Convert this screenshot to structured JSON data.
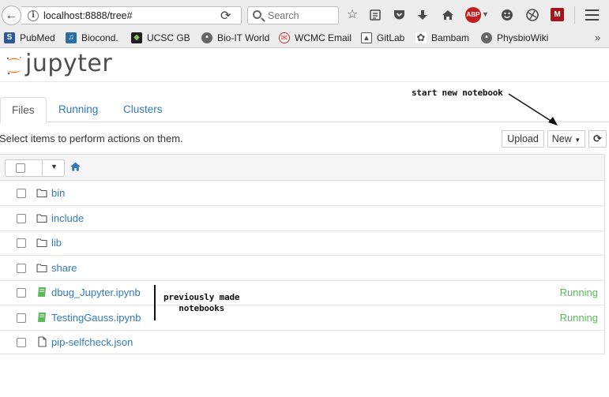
{
  "browser": {
    "url": "localhost:8888/tree#",
    "search_placeholder": "Search",
    "abp_label": "ABP",
    "bookmarks": [
      {
        "label": "PubMed",
        "icon": "pubmed-icon",
        "color": "#2a5a9b"
      },
      {
        "label": "Biocond.",
        "icon": "bioconductor-icon",
        "color": "#2b6ca3"
      },
      {
        "label": "UCSC GB",
        "icon": "ucsc-icon",
        "color": "#1f1f1f"
      },
      {
        "label": "Bio-IT World",
        "icon": "globe-icon",
        "color": "#666666"
      },
      {
        "label": "WCMC Email",
        "icon": "email-icon",
        "color": "#c62828"
      },
      {
        "label": "GitLab",
        "icon": "gitlab-icon",
        "color": "#555555"
      },
      {
        "label": "Bambam",
        "icon": "bambam-icon",
        "color": "#555555"
      },
      {
        "label": "PhysbioWiki",
        "icon": "globe-icon",
        "color": "#666666"
      }
    ]
  },
  "app": {
    "logo_text": "jupyter",
    "accent_color": "#f37726"
  },
  "tabs": [
    {
      "label": "Files",
      "active": true
    },
    {
      "label": "Running",
      "active": false
    },
    {
      "label": "Clusters",
      "active": false
    }
  ],
  "toolbar": {
    "select_message": "Select items to perform actions on them.",
    "upload_label": "Upload",
    "new_label": "New"
  },
  "annotations": {
    "new_notebook": "start new notebook",
    "previous_line1": "previously made",
    "previous_line2": "notebooks"
  },
  "files": [
    {
      "name": "bin",
      "type": "folder",
      "status": ""
    },
    {
      "name": "include",
      "type": "folder",
      "status": ""
    },
    {
      "name": "lib",
      "type": "folder",
      "status": ""
    },
    {
      "name": "share",
      "type": "folder",
      "status": ""
    },
    {
      "name": "dbug_Jupyter.ipynb",
      "type": "notebook",
      "status": "Running"
    },
    {
      "name": "TestingGauss.ipynb",
      "type": "notebook",
      "status": "Running"
    },
    {
      "name": "pip-selfcheck.json",
      "type": "file",
      "status": ""
    }
  ],
  "colors": {
    "link": "#337ab7",
    "running": "#5cb85c",
    "notebook_icon": "#5cb85c"
  }
}
